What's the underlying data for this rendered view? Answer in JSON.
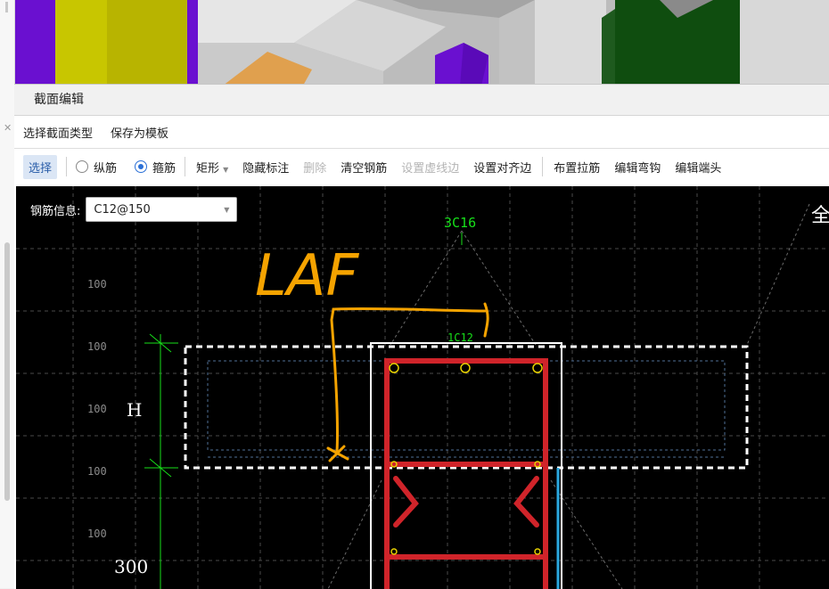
{
  "dialog": {
    "title": "截面编辑"
  },
  "menu": {
    "items": [
      "选择截面类型",
      "保存为模板"
    ]
  },
  "toolbar": {
    "select": "选择",
    "radio_longitudinal": "纵筋",
    "radio_stirrup": "箍筋",
    "shape": "矩形",
    "hide_labels": "隐藏标注",
    "delete": "删除",
    "clear_rebar": "清空钢筋",
    "set_dashed_edge": "设置虚线边",
    "set_align_edge": "设置对齐边",
    "place_tie": "布置拉筋",
    "edit_hook": "编辑弯钩",
    "edit_end": "编辑端头"
  },
  "rebar_info": {
    "label": "钢筋信息:",
    "value": "C12@150"
  },
  "drawing": {
    "top_rebar_label": "3C16",
    "stirrup_label": "1C12",
    "corner_text": "全",
    "dim_labels": [
      "100",
      "100",
      "100",
      "100",
      "100"
    ],
    "height_label": "H",
    "bottom_dim": "300",
    "handwriting": "LAF"
  },
  "colors": {
    "canvas_bg": "#000000",
    "stirrup": "#d0242a",
    "dimension": "#17e01a",
    "annotation": "#f5a300",
    "grid": "#4d4d4d",
    "toolbar_active": "#dbe6f5"
  }
}
